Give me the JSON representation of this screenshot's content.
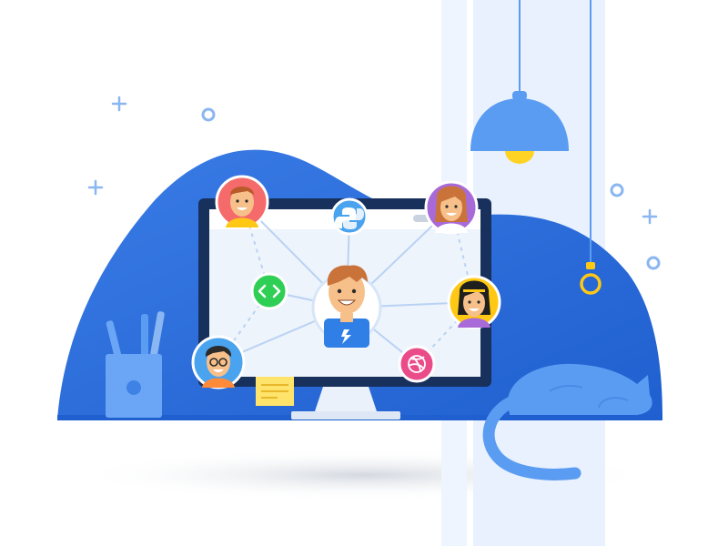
{
  "scene": {
    "colors": {
      "background": "#ffffff",
      "blob_blue": "#2f6fdd",
      "blob_blue_dark": "#1f5fcf",
      "light_beam": "#e8f1fd",
      "monitor_frame": "#17305c",
      "monitor_screen": "#eef4fc",
      "lamp_shade": "#5b9cf3",
      "lamp_bulb": "#ffd324",
      "cat": "#5b9cf3",
      "pen_cup": "#6aa6f5",
      "sticky_note": "#ffe36a",
      "code_badge": "#2fcf55",
      "python_badge": "#4aa3ee",
      "dribbble_badge": "#ea4c89",
      "avatar_red": "#f56a6a",
      "avatar_purple": "#a86ad8",
      "avatar_yellow": "#ffc815",
      "avatar_blue": "#4aa3ee"
    },
    "icons": {
      "code": "code-icon",
      "python": "python-icon",
      "dribbble": "dribbble-icon"
    }
  }
}
